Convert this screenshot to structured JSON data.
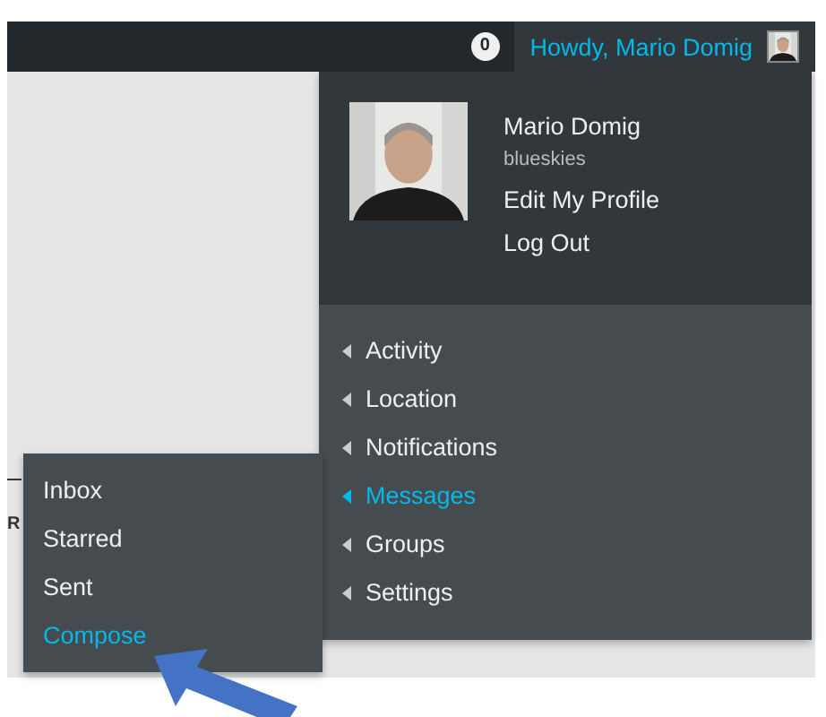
{
  "admin_bar": {
    "notification_count": "0",
    "greeting": "Howdy, Mario Domig"
  },
  "content": {
    "heading_fragment": "R"
  },
  "account_menu": {
    "display_name": "Mario Domig",
    "username": "blueskies",
    "links": [
      "Edit My Profile",
      "Log Out"
    ],
    "items": [
      {
        "label": "Activity",
        "selected": false
      },
      {
        "label": "Location",
        "selected": false
      },
      {
        "label": "Notifications",
        "selected": false
      },
      {
        "label": "Messages",
        "selected": true
      },
      {
        "label": "Groups",
        "selected": false
      },
      {
        "label": "Settings",
        "selected": false
      }
    ]
  },
  "messages_submenu": [
    {
      "label": "Inbox",
      "selected": false
    },
    {
      "label": "Starred",
      "selected": false
    },
    {
      "label": "Sent",
      "selected": false
    },
    {
      "label": "Compose",
      "selected": true
    }
  ]
}
